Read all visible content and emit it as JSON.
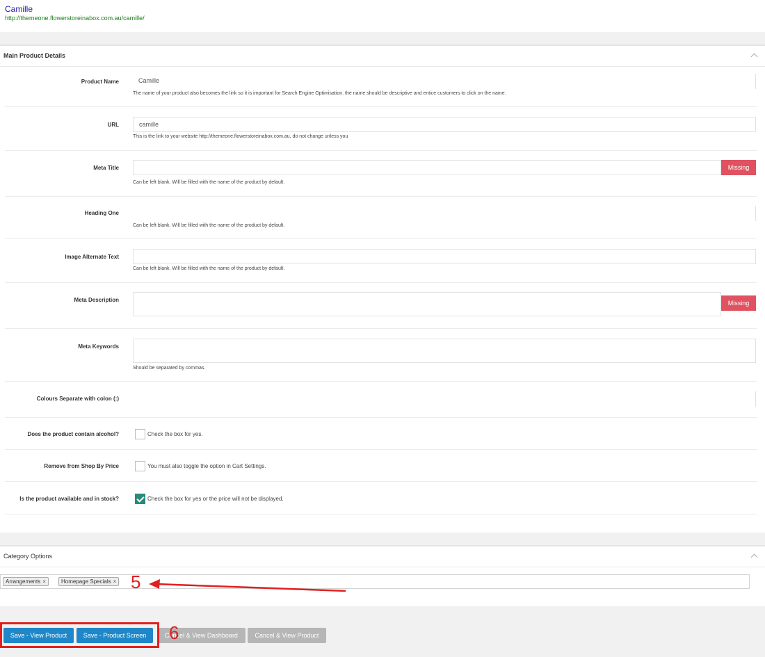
{
  "header": {
    "title": "Camille",
    "url": "http://themeone.flowerstoreinabox.com.au/camille/"
  },
  "main_panel": {
    "title": "Main Product Details",
    "fields": {
      "product_name": {
        "label": "Product Name",
        "value": "Camille",
        "help": "The name of your product also becomes the link so it is important for Search Engine Optimisation. the name should be descriptive and entice customers to click on the name."
      },
      "url": {
        "label": "URL",
        "value": "camille",
        "help": "This is the link to your website http://themeone.flowerstoreinabox.com.au, do not change unless you"
      },
      "meta_title": {
        "label": "Meta Title",
        "value": "",
        "badge": "Missing",
        "help": "Can be left blank. Will be filled with the name of the product by default."
      },
      "heading_one": {
        "label": "Heading One",
        "value": "",
        "help": "Can be left blank. Will be filled with the name of the product by default."
      },
      "image_alt": {
        "label": "Image Alternate Text",
        "value": "",
        "help": "Can be left blank. Will be filled with the name of the product by default."
      },
      "meta_description": {
        "label": "Meta Description",
        "value": "",
        "badge": "Missing"
      },
      "meta_keywords": {
        "label": "Meta Keywords",
        "value": "",
        "help": "Should be separated by commas."
      },
      "colours": {
        "label": "Colours Separate with colon (:)",
        "value": ""
      }
    },
    "checkboxes": {
      "alcohol": {
        "label": "Does the product contain alcohol?",
        "text": "Check the box for yes.",
        "checked": false
      },
      "shop_by_price": {
        "label": "Remove from Shop By Price",
        "text": "You must also toggle the option in Cart Settings.",
        "checked": false
      },
      "in_stock": {
        "label": "Is the product available and in stock?",
        "text": "Check the box for yes or the price will not be displayed.",
        "checked": true
      }
    }
  },
  "category_panel": {
    "title": "Category Options",
    "tags": [
      "Arrangements",
      "Homepage Specials"
    ],
    "tag_remove": "×"
  },
  "annotations": {
    "arrow_label": "5",
    "box_label": "6",
    "color": "#e02020"
  },
  "buttons": {
    "save_view_product": "Save - View Product",
    "save_product_screen": "Save - Product Screen",
    "cancel_view_dashboard": "Cancel & View Dashboard",
    "cancel_view_product": "Cancel & View Product"
  }
}
